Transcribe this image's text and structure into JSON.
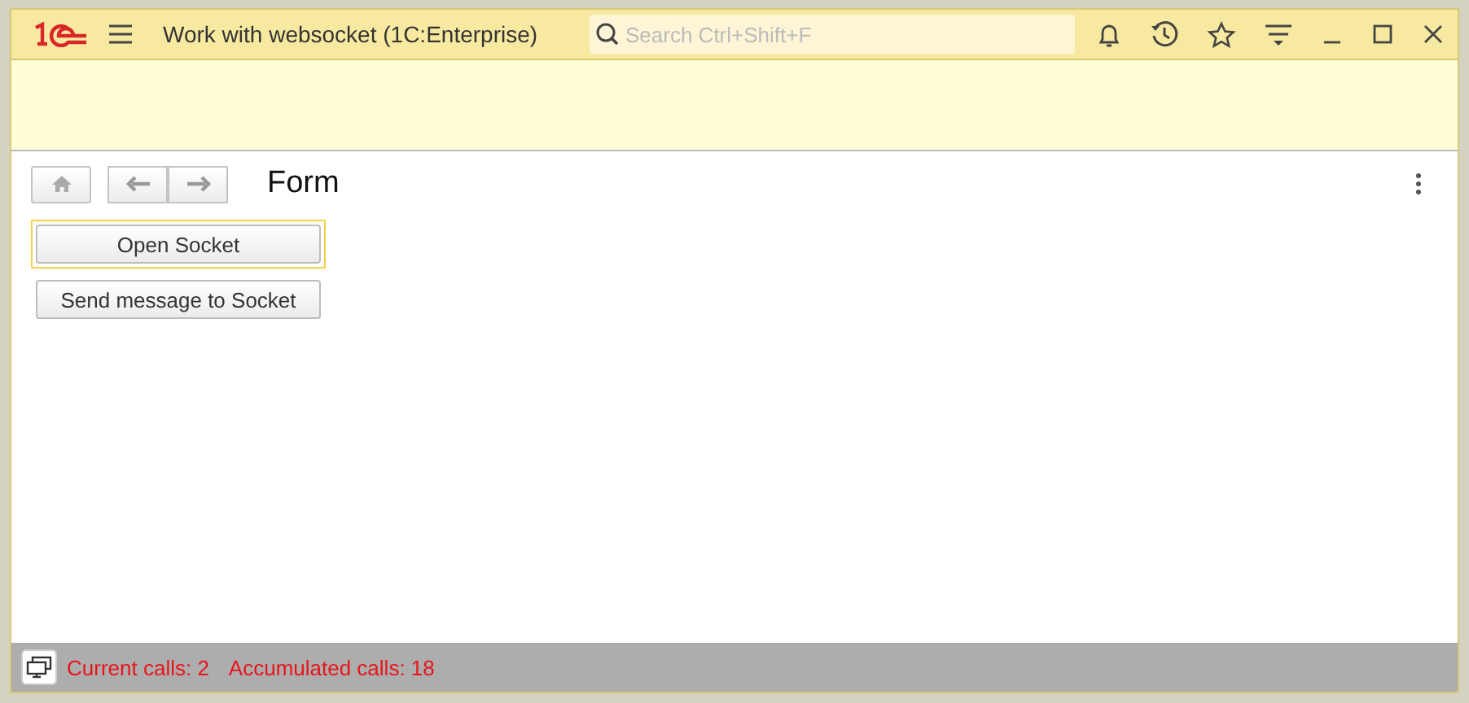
{
  "window": {
    "title": "Work with websocket  (1C:Enterprise)"
  },
  "search": {
    "placeholder": "Search Ctrl+Shift+F"
  },
  "form": {
    "title": "Form"
  },
  "buttons": [
    {
      "label": "Open Socket",
      "focused": true
    },
    {
      "label": "Send message to Socket",
      "focused": false
    }
  ],
  "status_bar": {
    "current_calls": "Current calls: 2",
    "accumulated_calls": "Accumulated calls: 18"
  }
}
